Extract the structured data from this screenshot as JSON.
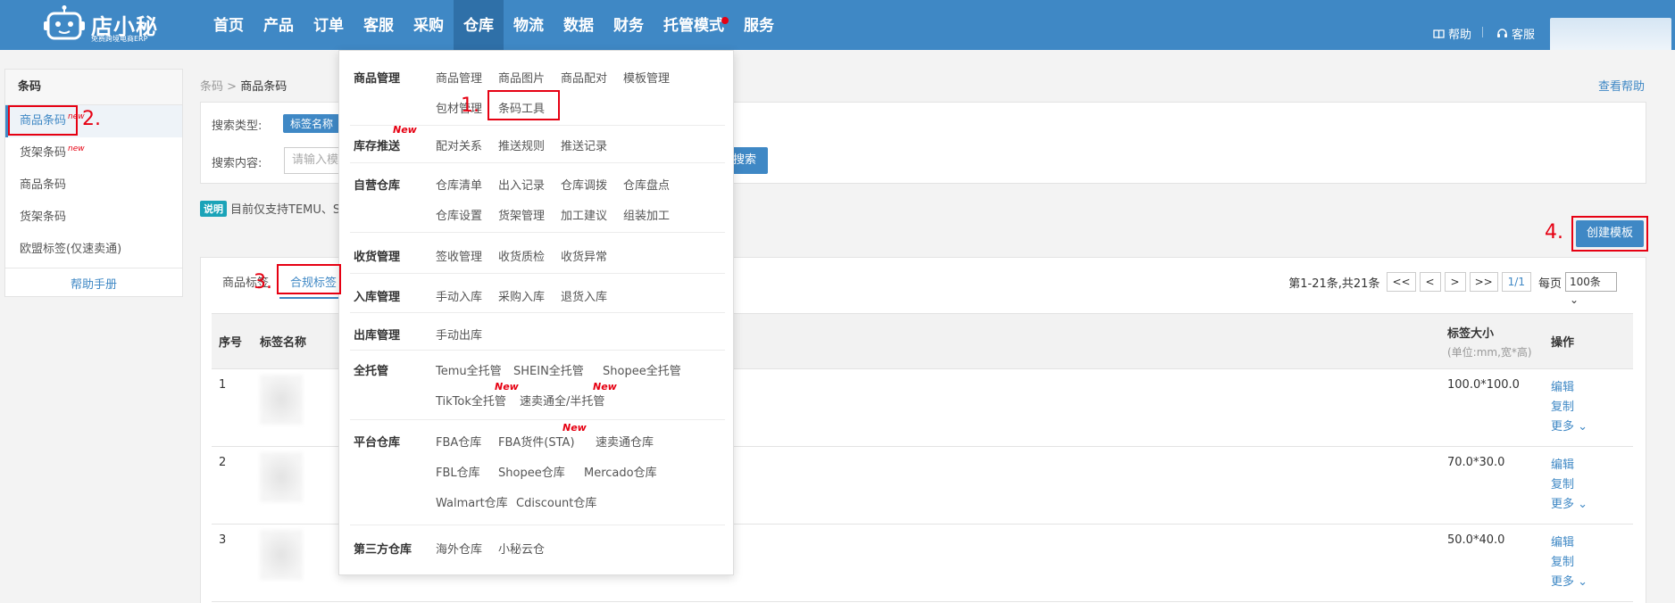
{
  "header": {
    "logo_name": "店小秘",
    "logo_sub": "免费跨境电商ERP",
    "nav": [
      {
        "label": "首页"
      },
      {
        "label": "产品"
      },
      {
        "label": "订单"
      },
      {
        "label": "客服"
      },
      {
        "label": "采购"
      },
      {
        "label": "仓库",
        "active": true
      },
      {
        "label": "物流"
      },
      {
        "label": "数据"
      },
      {
        "label": "财务"
      },
      {
        "label": "托管模式",
        "dot": true
      },
      {
        "label": "服务"
      }
    ],
    "help": "帮助",
    "service": "客服"
  },
  "sidebar": {
    "title": "条码",
    "items": [
      {
        "label": "商品条码",
        "new": "new",
        "active": true
      },
      {
        "label": "货架条码",
        "new": "new"
      },
      {
        "label": "商品条码"
      },
      {
        "label": "货架条码"
      },
      {
        "label": "欧盟标签(仅速卖通)"
      }
    ],
    "help": "帮助手册"
  },
  "breadcrumb": {
    "root": "条码",
    "sep": ">",
    "current": "商品条码"
  },
  "help_link": "查看帮助",
  "search": {
    "type_label": "搜索类型:",
    "type_value": "标签名称",
    "content_label": "搜索内容:",
    "placeholder": "请输入模",
    "button": "搜索"
  },
  "notice": {
    "badge": "说明",
    "text": "目前仅支持TEMU、S"
  },
  "create_button": "创建模板",
  "annotations": {
    "n1": "1.",
    "n2": "2.",
    "n3": "3.",
    "n4": "4."
  },
  "tabs": [
    {
      "label": "商品标签"
    },
    {
      "label": "合规标签",
      "active": true
    }
  ],
  "pager": {
    "summary": "第1-21条,共21条",
    "first": "<<",
    "prev": "<",
    "next": ">",
    "last": ">>",
    "page": "1/1",
    "per_page_label": "每页",
    "per_page": "100条"
  },
  "table": {
    "headers": {
      "no": "序号",
      "name": "标签名称",
      "size": "标签大小",
      "size_sub": "(单位:mm,宽*高)",
      "ops": "操作"
    },
    "rows": [
      {
        "no": "1",
        "size": "100.0*100.0"
      },
      {
        "no": "2",
        "size": "70.0*30.0"
      },
      {
        "no": "3",
        "size": "50.0*40.0"
      }
    ],
    "ops": {
      "edit": "编辑",
      "copy": "复制",
      "more": "更多"
    }
  },
  "menu": {
    "sections": [
      {
        "title": "商品管理",
        "links": [
          "商品管理",
          "商品图片",
          "商品配对",
          "模板管理",
          "包材管理",
          "条码工具"
        ]
      },
      {
        "title": "库存推送",
        "new": "New",
        "links": [
          "配对关系",
          "推送规则",
          "推送记录"
        ]
      },
      {
        "title": "自营仓库",
        "links": [
          "仓库清单",
          "出入记录",
          "仓库调拨",
          "仓库盘点",
          "仓库设置",
          "货架管理",
          "加工建议",
          "组装加工"
        ]
      },
      {
        "title": "收货管理",
        "links": [
          "签收管理",
          "收货质检",
          "收货异常"
        ]
      },
      {
        "title": "入库管理",
        "links": [
          "手动入库",
          "采购入库",
          "退货入库"
        ]
      },
      {
        "title": "出库管理",
        "links": [
          "手动出库"
        ]
      },
      {
        "title": "全托管",
        "links": [
          "Temu全托管",
          "SHEIN全托管",
          "Shopee全托管",
          "TikTok全托管",
          "速卖通全/半托管"
        ],
        "new": "New"
      },
      {
        "title": "平台仓库",
        "links": [
          "FBA仓库",
          "FBA货件(STA)",
          "速卖通仓库",
          "FBL仓库",
          "Shopee仓库",
          "Mercado仓库",
          "Walmart仓库",
          "Cdiscount仓库"
        ],
        "new": "New"
      },
      {
        "title": "第三方仓库",
        "links": [
          "海外仓库",
          "小秘云仓"
        ]
      }
    ]
  },
  "colors": {
    "primary": "#3f88c5",
    "annotation": "#e60012",
    "new_tag": "#e60012"
  }
}
